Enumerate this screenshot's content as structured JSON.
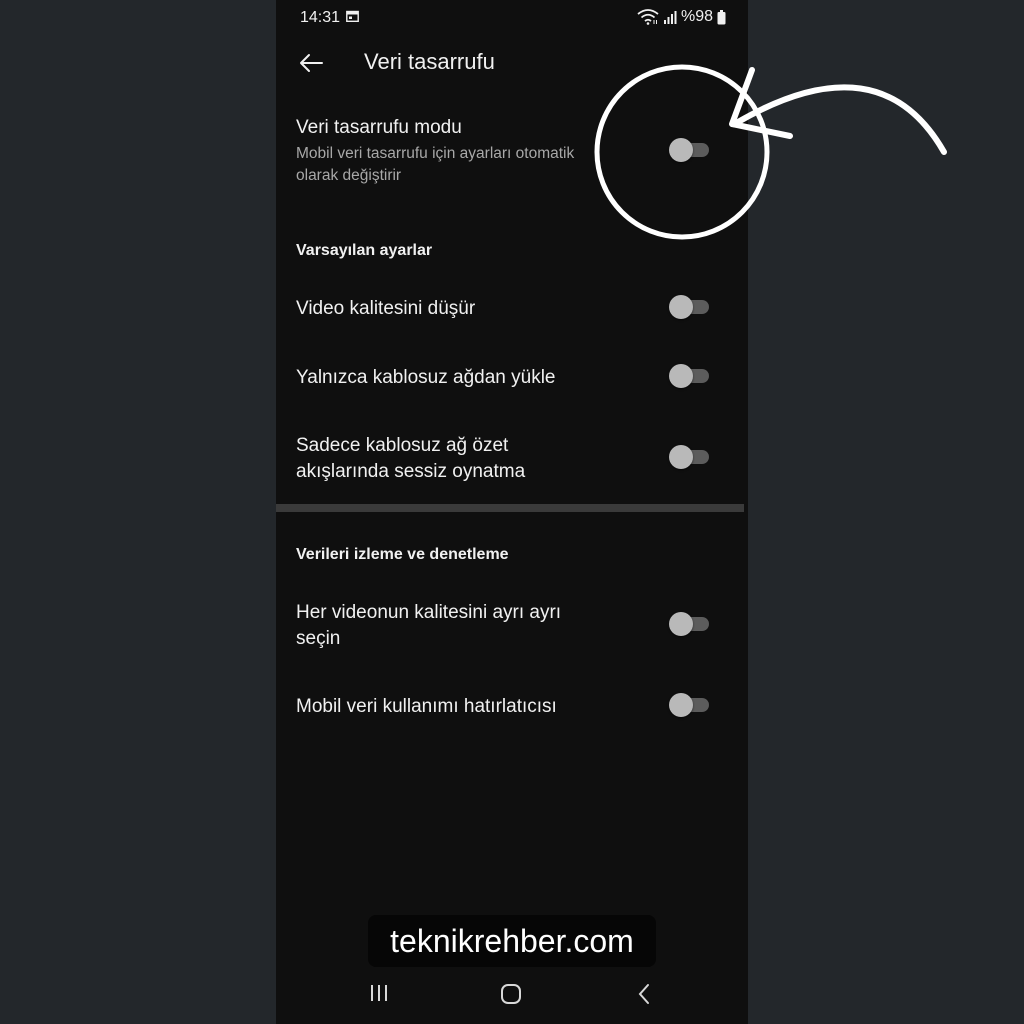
{
  "status_bar": {
    "time": "14:31",
    "battery_text": "%98"
  },
  "header": {
    "title": "Veri tasarrufu"
  },
  "data_saver": {
    "title": "Veri tasarrufu modu",
    "subtitle_line1": "Mobil veri tasarrufu için ayarları otomatik",
    "subtitle_line2": "olarak değiştirir",
    "enabled": false
  },
  "default_settings": {
    "heading": "Varsayılan ayarlar",
    "items": [
      {
        "label_line1": "Video kalitesini düşür",
        "label_line2": "",
        "enabled": false
      },
      {
        "label_line1": "Yalnızca kablosuz ağdan yükle",
        "label_line2": "",
        "enabled": false
      },
      {
        "label_line1": "Sadece kablosuz ağ özet",
        "label_line2": "akışlarında sessiz oynatma",
        "enabled": false
      }
    ]
  },
  "monitoring": {
    "heading": "Verileri izleme ve denetleme",
    "items": [
      {
        "label_line1": "Her videonun kalitesini ayrı ayrı",
        "label_line2": "seçin",
        "enabled": false
      },
      {
        "label_line1": "Mobil veri kullanımı hatırlatıcısı",
        "label_line2": "",
        "enabled": false
      }
    ]
  },
  "watermark": {
    "text": "teknikrehber.com"
  },
  "nav_bar": {
    "icons": [
      "recent-apps-icon",
      "home-icon",
      "back-nav-icon"
    ]
  },
  "colors": {
    "background": "#23272b",
    "screen": "#0f0f0f",
    "toggle_off_knob": "#b9b9b9",
    "toggle_off_track": "#5c5c5c",
    "annotation": "#ffffff"
  }
}
